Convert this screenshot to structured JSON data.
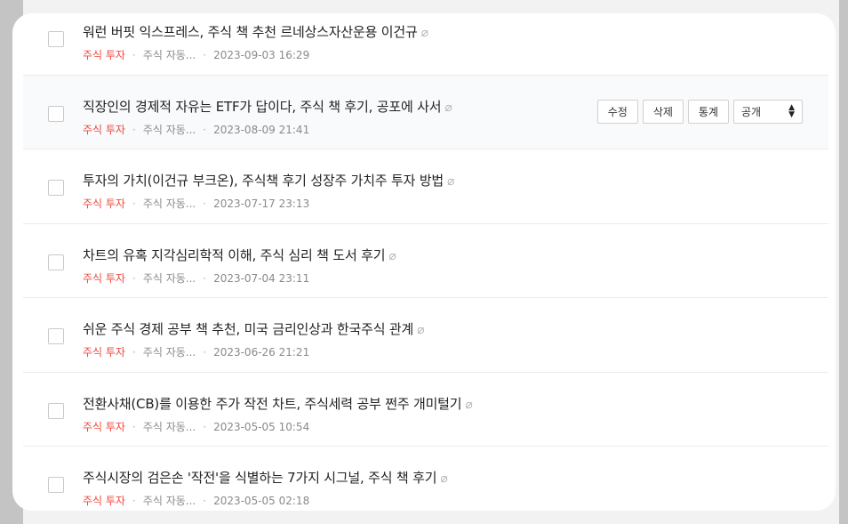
{
  "posts": [
    {
      "title": "워런 버핏 익스프레스, 주식 책 추천 르네상스자산운용 이건규",
      "category": "주식 투자",
      "subcategory": "주식 자동...",
      "date": "2023-09-03 16:29"
    },
    {
      "title": "직장인의 경제적 자유는 ETF가 답이다, 주식 책 후기, 공포에 사서",
      "category": "주식 투자",
      "subcategory": "주식 자동...",
      "date": "2023-08-09 21:41"
    },
    {
      "title": "투자의 가치(이건규 부크온), 주식책 후기 성장주 가치주 투자 방법",
      "category": "주식 투자",
      "subcategory": "주식 자동...",
      "date": "2023-07-17 23:13"
    },
    {
      "title": "차트의 유혹 지각심리학적 이해, 주식 심리 책 도서 후기",
      "category": "주식 투자",
      "subcategory": "주식 자동...",
      "date": "2023-07-04 23:11"
    },
    {
      "title": "쉬운 주식 경제 공부 책 추천, 미국 금리인상과 한국주식 관계",
      "category": "주식 투자",
      "subcategory": "주식 자동...",
      "date": "2023-06-26 21:21"
    },
    {
      "title": "전환사채(CB)를 이용한 주가 작전 차트, 주식세력 공부 쩐주 개미털기",
      "category": "주식 투자",
      "subcategory": "주식 자동...",
      "date": "2023-05-05 10:54"
    },
    {
      "title": "주식시장의 검은손 '작전'을 식별하는 7가지 시그널, 주식 책 후기",
      "category": "주식 투자",
      "subcategory": "주식 자동...",
      "date": "2023-05-05 02:18"
    }
  ],
  "actions": {
    "edit_label": "수정",
    "delete_label": "삭제",
    "stats_label": "통계",
    "visibility_value": "공개"
  },
  "meta": {
    "dot": "·",
    "attachment_icon": "paperclip-icon"
  },
  "colors": {
    "category": "#f0473d",
    "background": "#c4c4c4",
    "hover_row": "#f9fafc"
  }
}
